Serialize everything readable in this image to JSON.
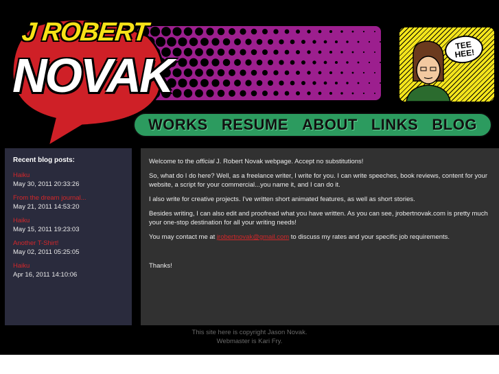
{
  "logo": {
    "line1": "J ROBERT",
    "line2": "NOVAK"
  },
  "comic": {
    "bubble": "TEE HEE!"
  },
  "nav": [
    {
      "label": "WORKS"
    },
    {
      "label": "RESUME"
    },
    {
      "label": "ABOUT"
    },
    {
      "label": "LINKS"
    },
    {
      "label": "BLOG"
    }
  ],
  "sidebar": {
    "title": "Recent blog posts:",
    "posts": [
      {
        "title": "Haiku",
        "date": "May 30, 2011 20:33:26"
      },
      {
        "title": "From the dream journal...",
        "date": "May 21, 2011 14:53:20"
      },
      {
        "title": "Haiku",
        "date": "May 15, 2011 19:23:03"
      },
      {
        "title": "Another T-Shirt!",
        "date": "May 02, 2011 05:25:05"
      },
      {
        "title": "Haiku",
        "date": "Apr 16, 2011 14:10:06"
      }
    ]
  },
  "main": {
    "p1_before": "Welcome to the ",
    "p1_em": "official",
    "p1_after": " J. Robert Novak webpage.  Accept no substitutions!",
    "p2": "So, what do I do here?  Well, as a freelance writer, I write for you.  I can write speeches, book reviews,  content for your website, a script for your commercial...you name it, and I can do it.",
    "p3": "I also write for creative projects.  I've written short animated features, as well as short stories.",
    "p4": "Besides writing, I can also edit and proofread what you have written.  As you can see, jrobertnovak.com is pretty much your one-stop destination for all your writing needs!",
    "p5_before": "You may contact me at ",
    "p5_email": "jrobertnovak@gmail.com",
    "p5_after": " to discuss my rates and your specific job requirements.",
    "p6": "Thanks!"
  },
  "footer": {
    "line1": "This site here is copyright Jason Novak.",
    "line2": "Webmaster is Kari Fry."
  },
  "colors": {
    "accent_red": "#d4272a",
    "nav_green": "#2c9b5f",
    "halftone_purple": "#9c1f8e",
    "comic_yellow": "#f4e51c"
  }
}
